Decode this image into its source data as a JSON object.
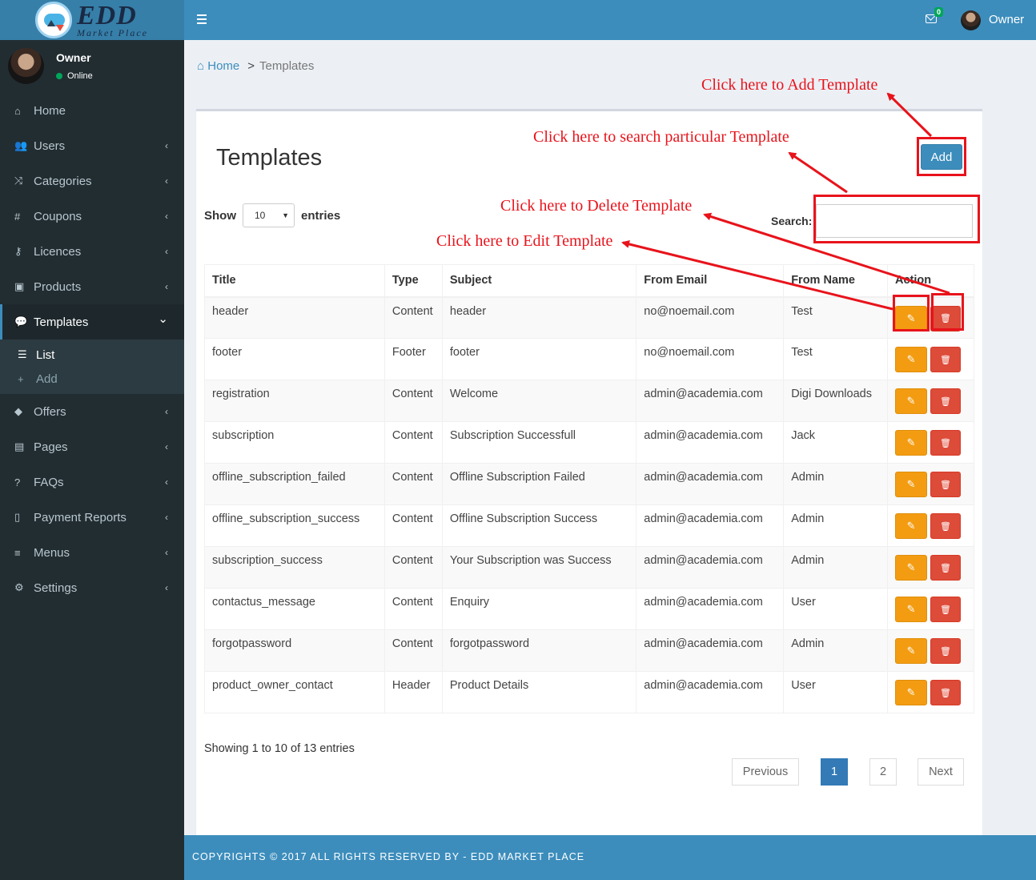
{
  "logo": {
    "main": "EDD",
    "sub": "Market Place"
  },
  "topbar": {
    "mail_badge": "0",
    "user_name": "Owner"
  },
  "sidebar": {
    "user": {
      "name": "Owner",
      "status": "Online"
    },
    "items": [
      {
        "label": "Home",
        "icon": "home-icon",
        "glyph": "⌂"
      },
      {
        "label": "Users",
        "icon": "users-icon",
        "glyph": "👥"
      },
      {
        "label": "Categories",
        "icon": "random-icon",
        "glyph": "⤨"
      },
      {
        "label": "Coupons",
        "icon": "hash-icon",
        "glyph": "#"
      },
      {
        "label": "Licences",
        "icon": "key-icon",
        "glyph": "⚷"
      },
      {
        "label": "Products",
        "icon": "briefcase-icon",
        "glyph": "▣"
      },
      {
        "label": "Templates",
        "icon": "comment-icon",
        "glyph": "💬"
      },
      {
        "label": "Offers",
        "icon": "tags-icon",
        "glyph": "◆"
      },
      {
        "label": "Pages",
        "icon": "file-icon",
        "glyph": "▤"
      },
      {
        "label": "FAQs",
        "icon": "question-icon",
        "glyph": "?"
      },
      {
        "label": "Payment Reports",
        "icon": "file-o-icon",
        "glyph": "▯"
      },
      {
        "label": "Menus",
        "icon": "bars-icon",
        "glyph": "≡"
      },
      {
        "label": "Settings",
        "icon": "gear-icon",
        "glyph": "⚙"
      }
    ],
    "submenu": [
      {
        "label": "List",
        "icon": "list-icon",
        "glyph": "☰"
      },
      {
        "label": "Add",
        "icon": "plus-icon",
        "glyph": "+"
      }
    ]
  },
  "breadcrumb": {
    "home": "Home",
    "separator": ">",
    "current": "Templates"
  },
  "box": {
    "title": "Templates",
    "add_label": "Add",
    "show_label": "Show",
    "entries_value": "10",
    "entries_label": "entries",
    "search_label": "Search:"
  },
  "table": {
    "headers": [
      "Title",
      "Type",
      "Subject",
      "From Email",
      "From Name",
      "Action"
    ],
    "rows": [
      [
        "header",
        "Content",
        "header",
        "no@noemail.com",
        "Test"
      ],
      [
        "footer",
        "Footer",
        "footer",
        "no@noemail.com",
        "Test"
      ],
      [
        "registration",
        "Content",
        "Welcome",
        "admin@academia.com",
        "Digi Downloads"
      ],
      [
        "subscription",
        "Content",
        "Subscription Successfull",
        "admin@academia.com",
        "Jack"
      ],
      [
        "offline_subscription_failed",
        "Content",
        "Offline Subscription Failed",
        "admin@academia.com",
        "Admin"
      ],
      [
        "offline_subscription_success",
        "Content",
        "Offline Subscription Success",
        "admin@academia.com",
        "Admin"
      ],
      [
        "subscription_success",
        "Content",
        "Your Subscription was Success",
        "admin@academia.com",
        "Admin"
      ],
      [
        "contactus_message",
        "Content",
        "Enquiry",
        "admin@academia.com",
        "User"
      ],
      [
        "forgotpassword",
        "Content",
        "forgotpassword",
        "admin@academia.com",
        "Admin"
      ],
      [
        "product_owner_contact",
        "Header",
        "Product Details",
        "admin@academia.com",
        "User"
      ]
    ]
  },
  "pagination": {
    "info": "Showing 1 to 10 of 13 entries",
    "previous": "Previous",
    "pages": [
      "1",
      "2"
    ],
    "next": "Next"
  },
  "footer": {
    "text": "COPYRIGHTS © 2017 ALL RIGHTS RESERVED BY - EDD MARKET PLACE"
  },
  "annotations": {
    "add": "Click here to Add Template",
    "search": "Click here to search particular Template",
    "delete": "Click here to Delete Template",
    "edit": "Click here to Edit Template",
    "color": "#e8131b"
  }
}
